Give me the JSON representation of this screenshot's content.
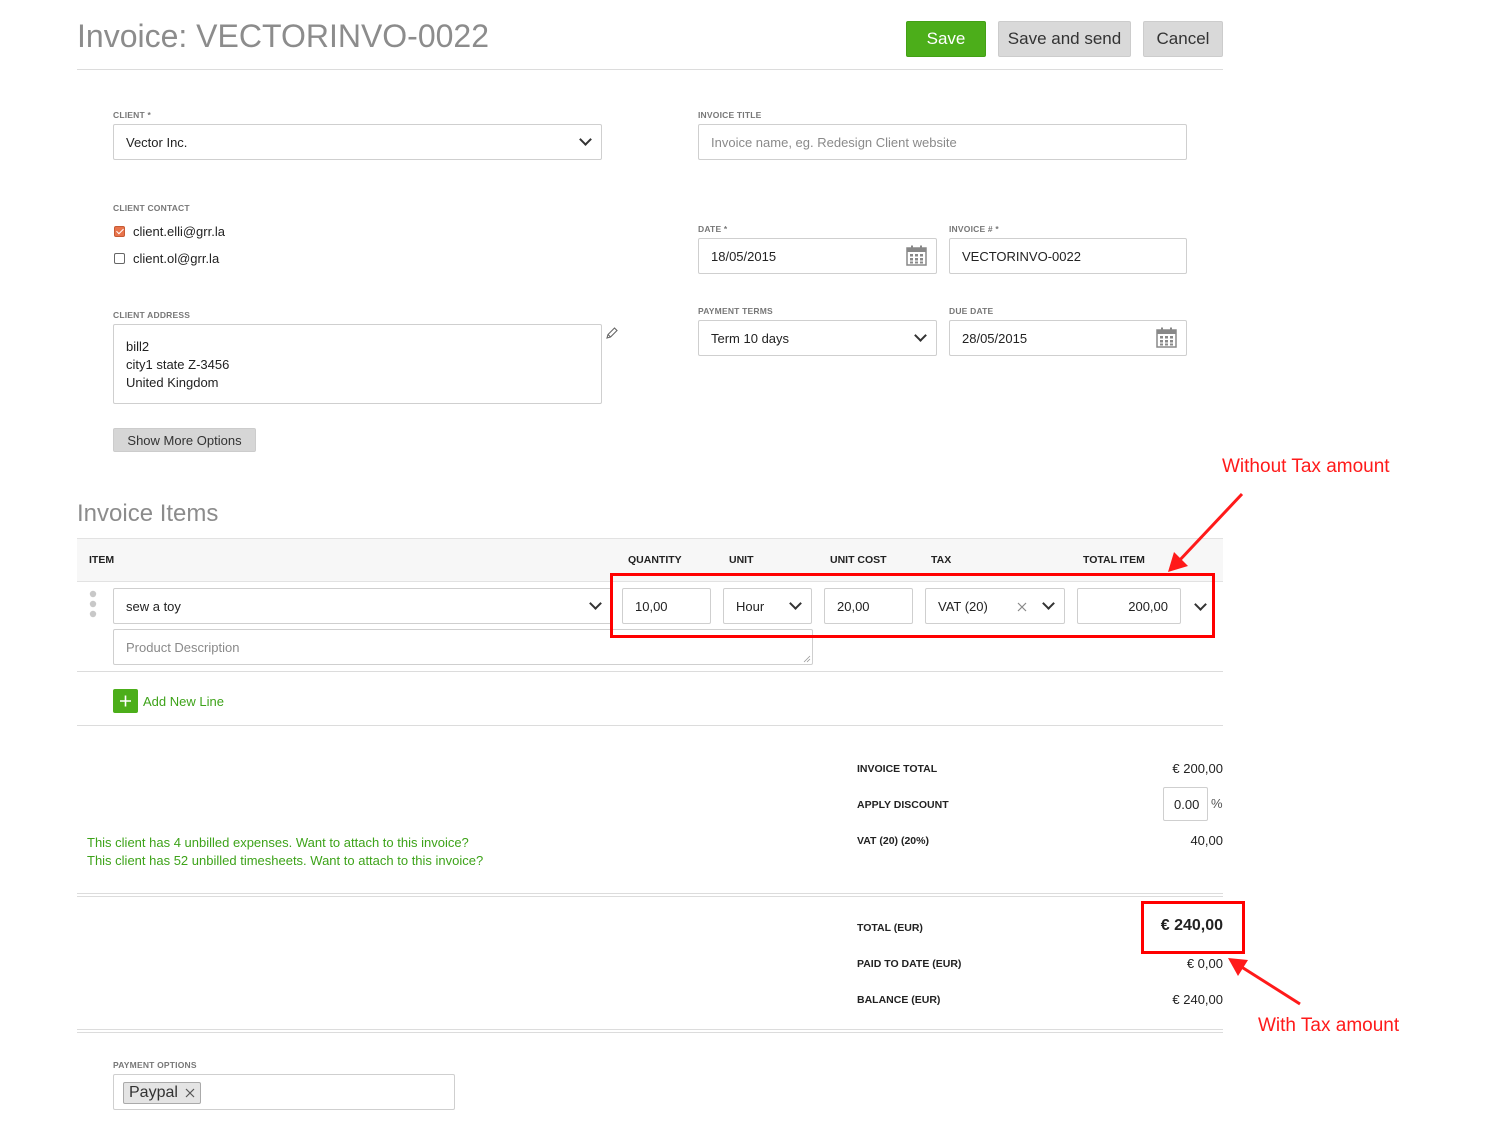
{
  "header": {
    "title": "Invoice: VECTORINVO-0022",
    "save_label": "Save",
    "save_send_label": "Save and send",
    "cancel_label": "Cancel"
  },
  "client": {
    "label": "CLIENT *",
    "value": "Vector Inc."
  },
  "invoice_title": {
    "label": "INVOICE TITLE",
    "placeholder": "Invoice name, eg. Redesign Client website"
  },
  "client_contact": {
    "label": "CLIENT CONTACT",
    "contacts": [
      {
        "email": "client.elli@grr.la",
        "checked": true
      },
      {
        "email": "client.ol@grr.la",
        "checked": false
      }
    ]
  },
  "date": {
    "label": "DATE *",
    "value": "18/05/2015"
  },
  "invoice_number": {
    "label": "INVOICE # *",
    "value": "VECTORINVO-0022"
  },
  "client_address": {
    "label": "CLIENT ADDRESS",
    "lines": [
      "bill2",
      "city1 state Z-3456",
      "United Kingdom"
    ]
  },
  "payment_terms": {
    "label": "PAYMENT TERMS",
    "value": "Term 10 days"
  },
  "due_date": {
    "label": "DUE DATE",
    "value": "28/05/2015"
  },
  "show_more_label": "Show More Options",
  "items_section": {
    "title": "Invoice Items",
    "columns": {
      "item": "ITEM",
      "quantity": "QUANTITY",
      "unit": "UNIT",
      "unit_cost": "UNIT COST",
      "tax": "TAX",
      "total_item": "TOTAL ITEM"
    },
    "rows": [
      {
        "item": "sew a toy",
        "description_placeholder": "Product Description",
        "quantity": "10,00",
        "unit": "Hour",
        "unit_cost": "20,00",
        "tax": "VAT (20)",
        "total": "200,00"
      }
    ],
    "add_line_label": "Add New Line"
  },
  "summary": {
    "invoice_total_label": "INVOICE TOTAL",
    "invoice_total_value": "€ 200,00",
    "discount_label": "APPLY DISCOUNT",
    "discount_value": "0.00",
    "discount_unit": "%",
    "vat_label": "VAT (20) (20%)",
    "vat_value": "40,00",
    "total_label": "TOTAL (EUR)",
    "total_value": "€ 240,00",
    "paid_label": "PAID TO DATE (EUR)",
    "paid_value": "€ 0,00",
    "balance_label": "BALANCE (EUR)",
    "balance_value": "€ 240,00"
  },
  "notices": [
    "This client has 4 unbilled expenses. Want to attach to this invoice?",
    "This client has 52 unbilled timesheets. Want to attach to this invoice?"
  ],
  "payment_options": {
    "label": "PAYMENT OPTIONS",
    "tags": [
      "Paypal"
    ]
  },
  "annotations": {
    "without_tax": "Without Tax amount",
    "with_tax": "With Tax amount",
    "color": "#ff0000"
  },
  "colors": {
    "accent_green": "#4cae1a",
    "notice_green": "#3ea31a",
    "checkbox_orange": "#e8734b"
  }
}
